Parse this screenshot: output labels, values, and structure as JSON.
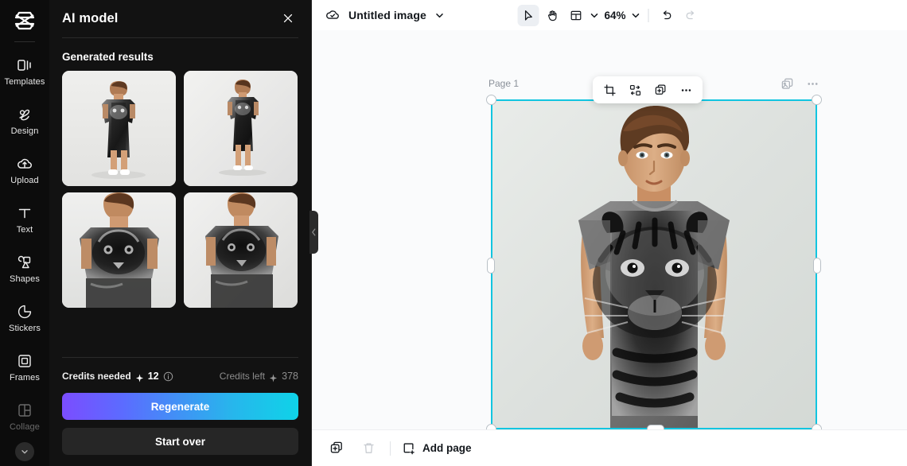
{
  "sidebar": {
    "logo_icon": "capcut-logo-icon",
    "items": [
      {
        "label": "Templates",
        "icon": "templates-icon",
        "dim": false
      },
      {
        "label": "Design",
        "icon": "design-icon",
        "dim": false
      },
      {
        "label": "Upload",
        "icon": "upload-cloud-icon",
        "dim": false
      },
      {
        "label": "Text",
        "icon": "text-icon",
        "dim": false
      },
      {
        "label": "Shapes",
        "icon": "shapes-icon",
        "dim": false
      },
      {
        "label": "Stickers",
        "icon": "stickers-icon",
        "dim": false
      },
      {
        "label": "Frames",
        "icon": "frames-icon",
        "dim": false
      },
      {
        "label": "Collage",
        "icon": "collage-icon",
        "dim": true
      }
    ],
    "collapse_icon": "chevron-down-icon"
  },
  "panel": {
    "title": "AI model",
    "close_icon": "close-icon",
    "section_title": "Generated results",
    "collapse_tab_icon": "chevron-left-icon",
    "results": [
      {
        "alt": "full-body model in tiger print tee dress with white sneakers"
      },
      {
        "alt": "full-body model in tiger print tee dress, side light"
      },
      {
        "alt": "half-body model in tiger print tee dress"
      },
      {
        "alt": "half-body model in tiger print tee dress, close crop"
      }
    ],
    "credits": {
      "needed_label": "Credits needed",
      "needed_value": "12",
      "needed_spark_icon": "sparkle-icon",
      "info_icon": "info-icon",
      "left_label": "Credits left",
      "left_value": "378",
      "left_spark_icon": "sparkle-icon"
    },
    "regenerate_label": "Regenerate",
    "start_over_label": "Start over"
  },
  "topbar": {
    "cloud_icon": "cloud-saved-icon",
    "doc_title": "Untitled image",
    "doc_chevron_icon": "chevron-down-icon",
    "select_tool_icon": "cursor-select-icon",
    "hand_tool_icon": "hand-pan-icon",
    "layout_tool_icon": "layout-grid-icon",
    "layout_chevron_icon": "chevron-down-icon",
    "zoom_value": "64%",
    "zoom_chevron_icon": "chevron-down-icon",
    "undo_icon": "undo-icon",
    "redo_icon": "redo-icon"
  },
  "canvas": {
    "page_label": "Page 1",
    "duplicate_page_icon": "duplicate-page-icon",
    "more_icon": "more-horizontal-icon",
    "rotate_icon": "rotate-icon",
    "image_alt": "AI generated male model wearing black and white tiger print t-shirt dress",
    "selection_color": "#12c5e0"
  },
  "float_toolbar": {
    "crop_icon": "crop-icon",
    "replace_icon": "swap-replace-icon",
    "duplicate_icon": "duplicate-icon",
    "more_icon": "more-horizontal-icon"
  },
  "bottombar": {
    "duplicate_icon": "duplicate-page-icon",
    "delete_icon": "trash-icon",
    "add_page_icon": "add-page-icon",
    "add_page_label": "Add page"
  }
}
